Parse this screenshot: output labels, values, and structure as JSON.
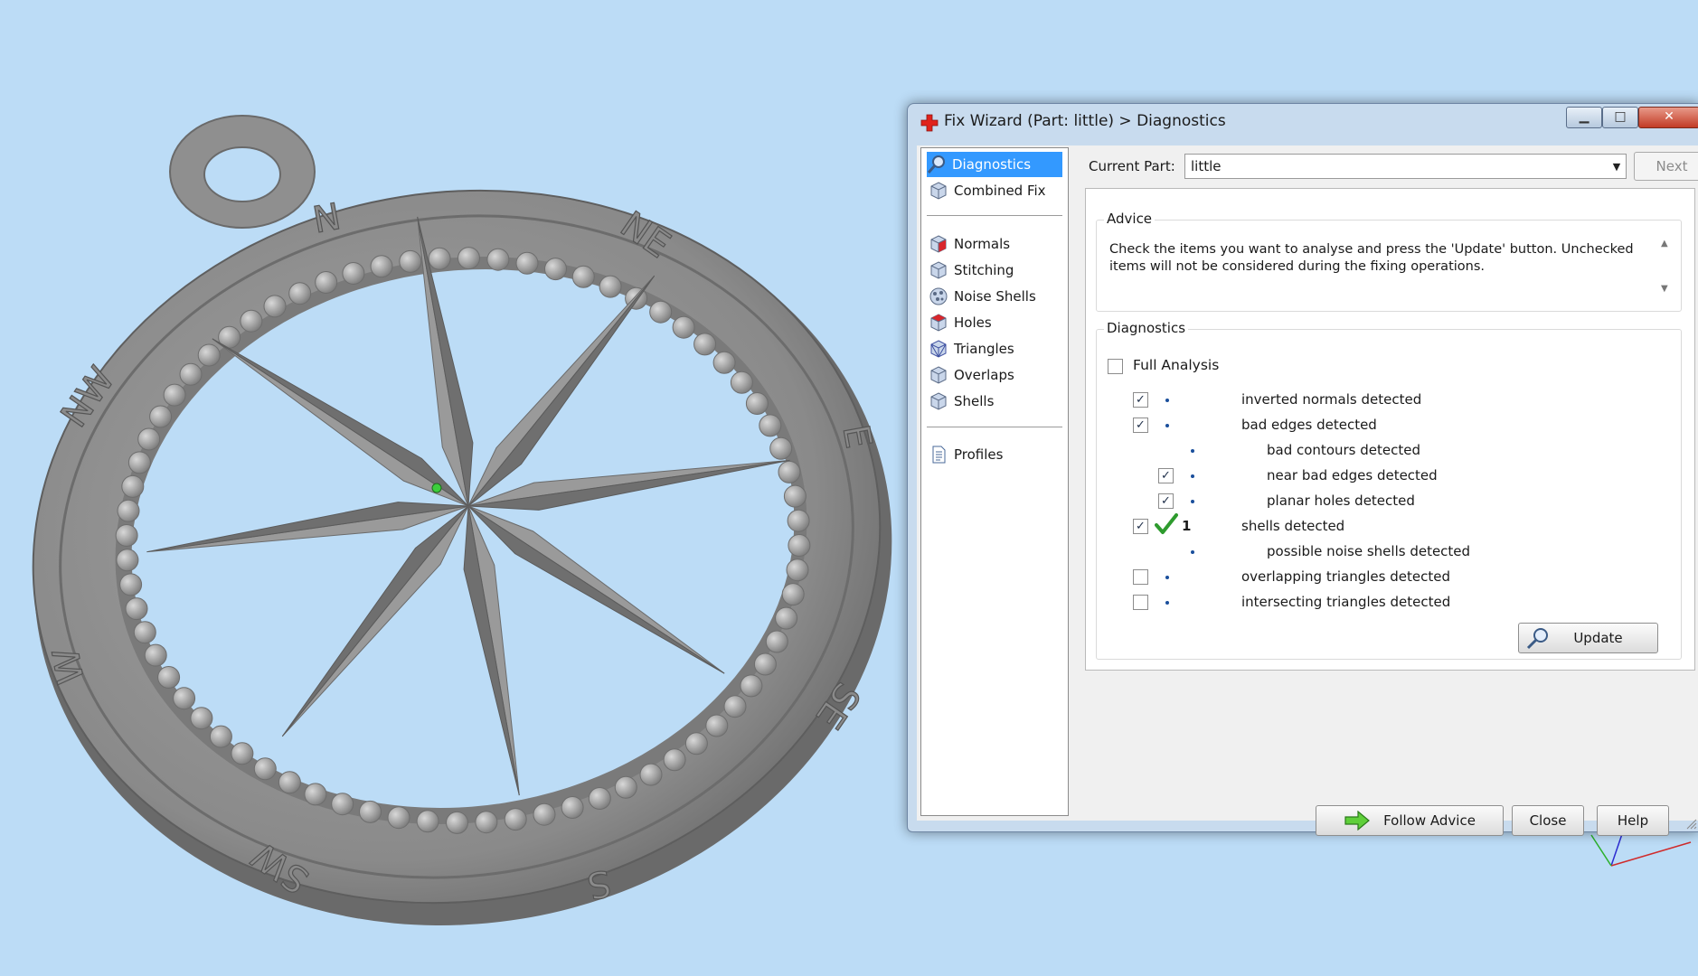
{
  "window": {
    "title": "Fix Wizard (Part: little) > Diagnostics",
    "minimize_glyph": "▁",
    "maximize_glyph": "□",
    "close_glyph": "✕"
  },
  "nav": {
    "items": [
      {
        "label": "Diagnostics",
        "icon": "magnifier-icon",
        "selected": true
      },
      {
        "label": "Combined Fix",
        "icon": "cube-icon"
      },
      {
        "label": "Normals",
        "icon": "cube-red-icon"
      },
      {
        "label": "Stitching",
        "icon": "cube-icon"
      },
      {
        "label": "Noise Shells",
        "icon": "noise-shells-icon"
      },
      {
        "label": "Holes",
        "icon": "cube-red-icon"
      },
      {
        "label": "Triangles",
        "icon": "cube-icon"
      },
      {
        "label": "Overlaps",
        "icon": "cube-icon"
      },
      {
        "label": "Shells",
        "icon": "cube-icon"
      },
      {
        "label": "Profiles",
        "icon": "document-icon"
      }
    ]
  },
  "current_part": {
    "label": "Current Part:",
    "value": "little",
    "next_label": "Next"
  },
  "advice": {
    "title": "Advice",
    "text": "Check the items you want to analyse and press the 'Update' button. Unchecked items will not be considered during the fixing operations."
  },
  "diagnostics": {
    "title": "Diagnostics",
    "full_analysis_label": "Full Analysis",
    "full_analysis_checked": false,
    "rows": [
      {
        "label": "inverted normals detected",
        "checked": true,
        "status": "",
        "level": 0
      },
      {
        "label": "bad edges detected",
        "checked": true,
        "status": "",
        "level": 0
      },
      {
        "label": "bad contours detected",
        "checked": null,
        "status": "",
        "level": 1
      },
      {
        "label": "near bad edges detected",
        "checked": true,
        "status": "",
        "level": 1
      },
      {
        "label": "planar holes detected",
        "checked": true,
        "status": "",
        "level": 1
      },
      {
        "label": "shells detected",
        "checked": true,
        "status": "ok",
        "count": "1",
        "level": 0
      },
      {
        "label": "possible noise shells detected",
        "checked": null,
        "status": "",
        "level": 1
      },
      {
        "label": "overlapping triangles detected",
        "checked": false,
        "status": "",
        "level": 0
      },
      {
        "label": "intersecting triangles detected",
        "checked": false,
        "status": "",
        "level": 0
      }
    ],
    "update_label": "Update"
  },
  "buttons": {
    "follow_advice": "Follow Advice",
    "close": "Close",
    "help": "Help"
  },
  "compass": {
    "labels": [
      "N",
      "NE",
      "E",
      "SE",
      "S",
      "SW",
      "W",
      "NW"
    ]
  },
  "colors": {
    "background": "#bcdcf6",
    "model": "#8d8d8d",
    "selection": "#3399ff",
    "check_green": "#2e9b2e",
    "dot_blue": "#1a4f9c"
  }
}
